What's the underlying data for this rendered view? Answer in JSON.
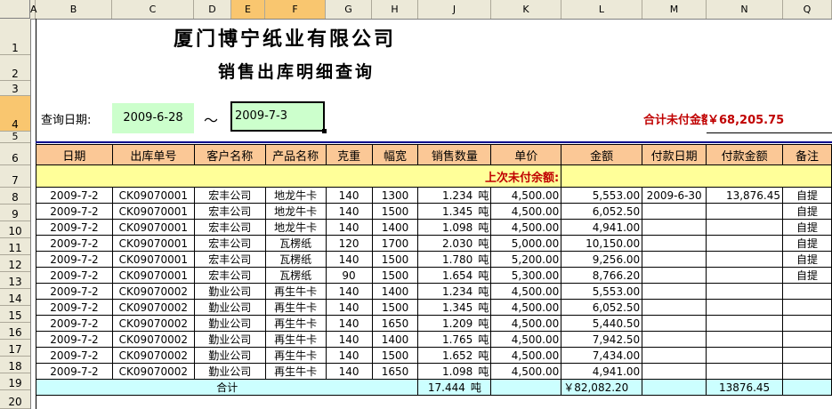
{
  "column_headers": [
    "A",
    "B",
    "C",
    "D",
    "E",
    "F",
    "G",
    "H",
    "J",
    "K",
    "L",
    "M",
    "N",
    "Q"
  ],
  "row_headers": [
    "1",
    "2",
    "3",
    "4",
    "5",
    "6",
    "7",
    "8",
    "9",
    "10",
    "11",
    "12",
    "13",
    "14",
    "15",
    "16",
    "17",
    "18",
    "19",
    "20"
  ],
  "company_title": "厦门博宁纸业有限公司",
  "report_title": "销售出库明细查询",
  "query": {
    "label": "查询日期:",
    "start_date": "2009-6-28",
    "separator": "～",
    "end_date": "2009-7-3"
  },
  "unpaid_total": {
    "label": "合计未付金额",
    "value": "￥68,205.75"
  },
  "table_headers": [
    "日期",
    "出库单号",
    "客户名称",
    "产品名称",
    "克重",
    "幅宽",
    "销售数量",
    "单价",
    "金额",
    "付款日期",
    "付款金额",
    "备注"
  ],
  "previous_unpaid_label": "上次未付余额:",
  "rows": [
    {
      "date": "2009-7-2",
      "order": "CK09070001",
      "customer": "宏丰公司",
      "product": "地龙牛卡",
      "gsm": "140",
      "width": "1300",
      "qty": "1.234",
      "unit": "吨",
      "price": "4,500.00",
      "amount": "5,553.00",
      "pay_date": "2009-6-30",
      "pay_amount": "13,876.45",
      "note": "自提"
    },
    {
      "date": "2009-7-2",
      "order": "CK09070001",
      "customer": "宏丰公司",
      "product": "地龙牛卡",
      "gsm": "140",
      "width": "1500",
      "qty": "1.345",
      "unit": "吨",
      "price": "4,500.00",
      "amount": "6,052.50",
      "pay_date": "",
      "pay_amount": "",
      "note": "自提"
    },
    {
      "date": "2009-7-2",
      "order": "CK09070001",
      "customer": "宏丰公司",
      "product": "地龙牛卡",
      "gsm": "140",
      "width": "1400",
      "qty": "1.098",
      "unit": "吨",
      "price": "4,500.00",
      "amount": "4,941.00",
      "pay_date": "",
      "pay_amount": "",
      "note": "自提"
    },
    {
      "date": "2009-7-2",
      "order": "CK09070001",
      "customer": "宏丰公司",
      "product": "瓦楞纸",
      "gsm": "120",
      "width": "1700",
      "qty": "2.030",
      "unit": "吨",
      "price": "5,000.00",
      "amount": "10,150.00",
      "pay_date": "",
      "pay_amount": "",
      "note": "自提"
    },
    {
      "date": "2009-7-2",
      "order": "CK09070001",
      "customer": "宏丰公司",
      "product": "瓦楞纸",
      "gsm": "140",
      "width": "1500",
      "qty": "1.780",
      "unit": "吨",
      "price": "5,200.00",
      "amount": "9,256.00",
      "pay_date": "",
      "pay_amount": "",
      "note": "自提"
    },
    {
      "date": "2009-7-2",
      "order": "CK09070001",
      "customer": "宏丰公司",
      "product": "瓦楞纸",
      "gsm": "90",
      "width": "1500",
      "qty": "1.654",
      "unit": "吨",
      "price": "5,300.00",
      "amount": "8,766.20",
      "pay_date": "",
      "pay_amount": "",
      "note": "自提"
    },
    {
      "date": "2009-7-2",
      "order": "CK09070002",
      "customer": "勤业公司",
      "product": "再生牛卡",
      "gsm": "140",
      "width": "1400",
      "qty": "1.234",
      "unit": "吨",
      "price": "4,500.00",
      "amount": "5,553.00",
      "pay_date": "",
      "pay_amount": "",
      "note": ""
    },
    {
      "date": "2009-7-2",
      "order": "CK09070002",
      "customer": "勤业公司",
      "product": "再生牛卡",
      "gsm": "140",
      "width": "1500",
      "qty": "1.345",
      "unit": "吨",
      "price": "4,500.00",
      "amount": "6,052.50",
      "pay_date": "",
      "pay_amount": "",
      "note": ""
    },
    {
      "date": "2009-7-2",
      "order": "CK09070002",
      "customer": "勤业公司",
      "product": "再生牛卡",
      "gsm": "140",
      "width": "1650",
      "qty": "1.209",
      "unit": "吨",
      "price": "4,500.00",
      "amount": "5,440.50",
      "pay_date": "",
      "pay_amount": "",
      "note": ""
    },
    {
      "date": "2009-7-2",
      "order": "CK09070002",
      "customer": "勤业公司",
      "product": "再生牛卡",
      "gsm": "140",
      "width": "1400",
      "qty": "1.765",
      "unit": "吨",
      "price": "4,500.00",
      "amount": "7,942.50",
      "pay_date": "",
      "pay_amount": "",
      "note": ""
    },
    {
      "date": "2009-7-2",
      "order": "CK09070002",
      "customer": "勤业公司",
      "product": "再生牛卡",
      "gsm": "140",
      "width": "1500",
      "qty": "1.652",
      "unit": "吨",
      "price": "4,500.00",
      "amount": "7,434.00",
      "pay_date": "",
      "pay_amount": "",
      "note": ""
    },
    {
      "date": "2009-7-2",
      "order": "CK09070002",
      "customer": "勤业公司",
      "product": "再生牛卡",
      "gsm": "140",
      "width": "1650",
      "qty": "1.098",
      "unit": "吨",
      "price": "4,500.00",
      "amount": "4,941.00",
      "pay_date": "",
      "pay_amount": "",
      "note": ""
    }
  ],
  "total_row": {
    "label": "合计",
    "qty": "17.444",
    "unit": "吨",
    "amount": "￥82,082.20",
    "pay_amount": "13876.45"
  }
}
